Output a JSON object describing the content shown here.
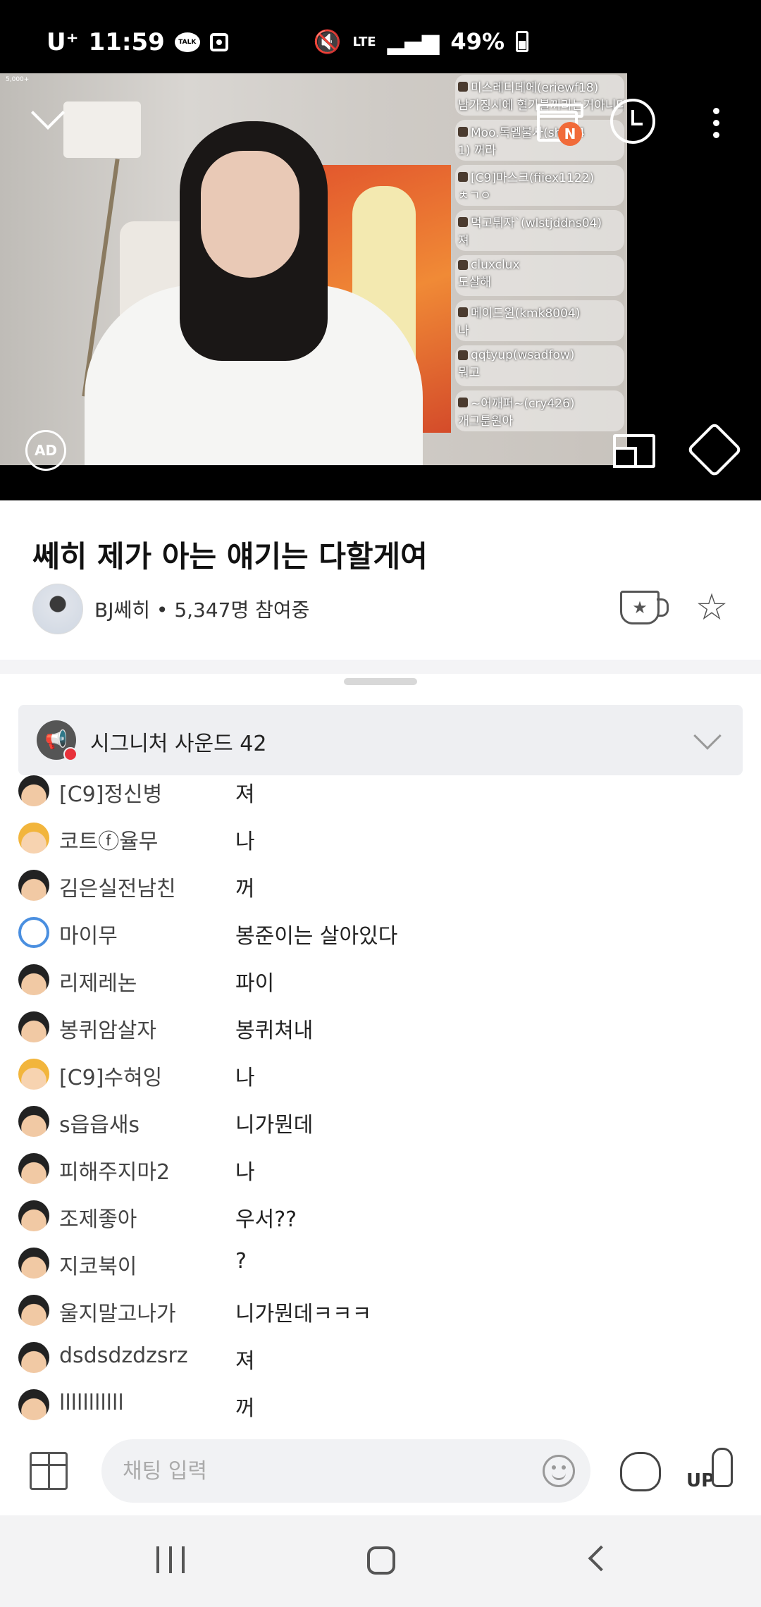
{
  "status_bar": {
    "carrier": "U⁺",
    "time": "11:59",
    "talk_badge": "TALK",
    "network": "LTE",
    "battery": "49%"
  },
  "video": {
    "viewer_watermark": "5,000+",
    "clip_badge": "N",
    "ad_label": "AD",
    "overlay_chat": [
      {
        "name": "미스레디데에(eriewf18)",
        "msg": "남가징시에 혈가불꺼라는거아니다"
      },
      {
        "name": "Moo.독멜불사(sh154",
        "msg": "1) 꺼라"
      },
      {
        "name": "[C9]마스크(fiiex1122)",
        "msg": "ㅊㄱㅇ"
      },
      {
        "name": "먹고튀자`(wlstjddns04)",
        "msg": "져"
      },
      {
        "name": "cluxclux",
        "msg": "도살해"
      },
      {
        "name": "메이드윈(kmk8004)",
        "msg": "나"
      },
      {
        "name": "qqtyup(wsadfow)",
        "msg": "뭐고"
      },
      {
        "name": "~어깨퍼~(cry426)",
        "msg": "개그툰원아"
      }
    ]
  },
  "broadcast": {
    "title": "쎄히 제가 아는 얘기는 다할게여",
    "streamer": "BJ쎄히",
    "participants": "5,347명 참여중",
    "separator": "•"
  },
  "notice": {
    "text": "시그니처 사운드 42"
  },
  "chat": [
    {
      "avatar": "dark",
      "name": "[C9]정신병",
      "msg": "져"
    },
    {
      "avatar": "blonde",
      "name": "코트ⓕ율무",
      "msg": "나"
    },
    {
      "avatar": "dark",
      "name": "김은실전남친",
      "msg": "꺼"
    },
    {
      "avatar": "bear",
      "name": "마이무",
      "msg": "봉준이는 살아있다"
    },
    {
      "avatar": "dark",
      "name": "리제레논",
      "msg": "파이"
    },
    {
      "avatar": "dark",
      "name": "봉퀴암살자",
      "msg": "봉퀴쳐내"
    },
    {
      "avatar": "blonde",
      "name": "[C9]수혀잉",
      "msg": "나"
    },
    {
      "avatar": "dark",
      "name": "s읍읍새s",
      "msg": "니가뭔데"
    },
    {
      "avatar": "dark",
      "name": "피해주지마2",
      "msg": "나"
    },
    {
      "avatar": "dark",
      "name": "조제좋아",
      "msg": "우서??"
    },
    {
      "avatar": "dark",
      "name": "지코북이",
      "msg": "?"
    },
    {
      "avatar": "dark",
      "name": "울지말고나가",
      "msg": "니가뭔데ㅋㅋㅋ"
    },
    {
      "avatar": "dark",
      "name": "dsdsdzdzsrz",
      "msg": "져"
    },
    {
      "avatar": "dark",
      "name": "lllllllllll",
      "msg": "꺼"
    }
  ],
  "input": {
    "placeholder": "채팅 입력",
    "up_label": "UP"
  },
  "colors": {
    "notice_alert": "#e8313a",
    "clip_badge": "#f16b3a",
    "status_bar_bg": "#000000"
  }
}
